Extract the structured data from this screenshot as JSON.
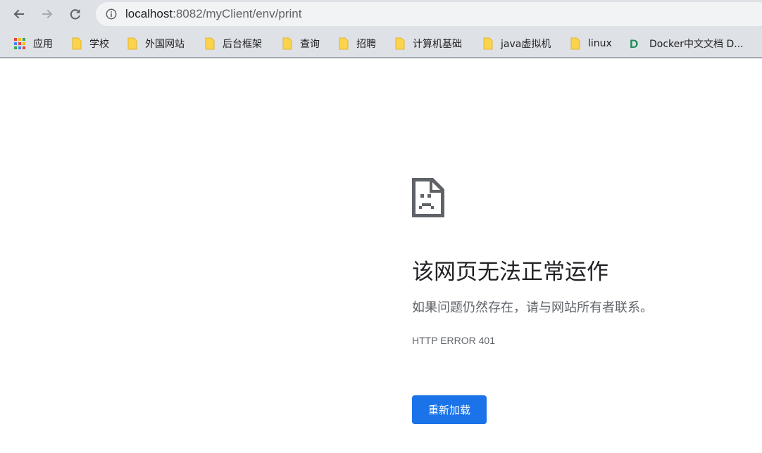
{
  "toolbar": {
    "back_icon": "arrow-left-icon",
    "forward_icon": "arrow-right-icon",
    "reload_icon": "reload-icon",
    "url_host": "localhost",
    "url_path": ":8082/myClient/env/print"
  },
  "bookmarks": [
    {
      "label": "应用",
      "icon": "apps-grid-icon"
    },
    {
      "label": "学校",
      "icon": "folder-icon"
    },
    {
      "label": "外国网站",
      "icon": "folder-icon"
    },
    {
      "label": "后台框架",
      "icon": "folder-icon"
    },
    {
      "label": "查询",
      "icon": "folder-icon"
    },
    {
      "label": "招聘",
      "icon": "folder-icon"
    },
    {
      "label": "计算机基础",
      "icon": "folder-icon"
    },
    {
      "label": "java虚拟机",
      "icon": "folder-icon"
    },
    {
      "label": "linux",
      "icon": "folder-icon"
    },
    {
      "label": "Docker中文文档 D...",
      "icon": "docker-d-icon"
    }
  ],
  "error": {
    "icon": "sad-page-icon",
    "title": "该网页无法正常运作",
    "subtitle": "如果问题仍然存在，请与网站所有者联系。",
    "code": "HTTP ERROR 401",
    "reload_label": "重新加载"
  },
  "colors": {
    "toolbar_bg": "#dee1e6",
    "omnibox_bg": "#f1f3f4",
    "button_blue": "#1a73e8",
    "folder_yellow": "#fcd34d",
    "docker_green": "#1e8e5a"
  }
}
